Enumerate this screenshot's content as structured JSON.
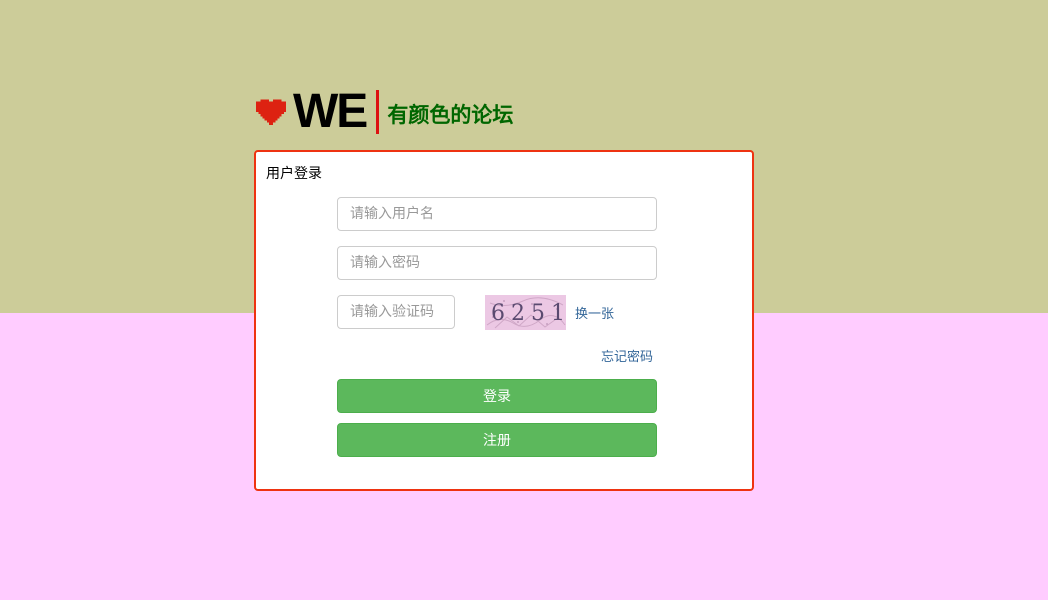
{
  "brand": {
    "logo_text": "WE",
    "slogan": "有颜色的论坛",
    "heart_color": "#dd2211",
    "divider_color": "#dd1111",
    "slogan_color": "#006600",
    "icon": "heart-icon"
  },
  "background": {
    "top_color": "#cccc99",
    "bottom_color": "#ffccff"
  },
  "login_panel": {
    "title": "用户登录",
    "border_color": "#ee3311",
    "username": {
      "value": "",
      "placeholder": "请输入用户名"
    },
    "password": {
      "value": "",
      "placeholder": "请输入密码"
    },
    "captcha_input": {
      "value": "",
      "placeholder": "请输入验证码"
    },
    "captcha_image_text": "6251",
    "refresh_captcha_label": "换一张",
    "forgot_password_label": "忘记密码",
    "login_button_label": "登录",
    "register_button_label": "注册",
    "button_color": "#5cb85c",
    "link_color": "#336699"
  }
}
